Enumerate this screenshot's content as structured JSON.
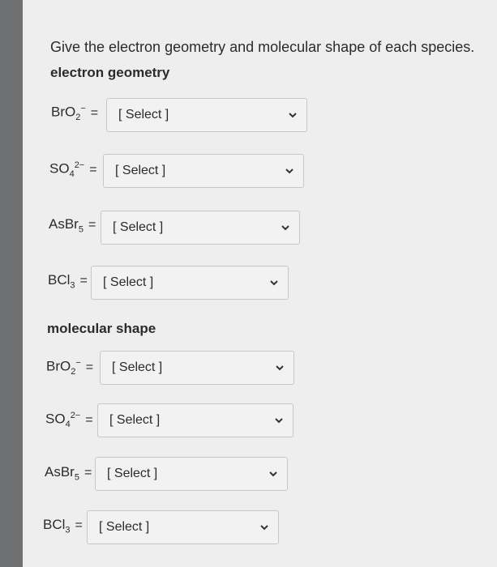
{
  "heading": "Give the electron geometry and molecular shape of each species.",
  "sections": {
    "electron_geometry": "electron geometry",
    "molecular_shape": "molecular shape"
  },
  "species": {
    "bro2": {
      "main": "BrO",
      "sub": "2",
      "sup": "−"
    },
    "so4": {
      "main": "SO",
      "sub": "4",
      "sup": "2−"
    },
    "asbr5": {
      "main": "AsBr",
      "sub": "5",
      "sup": ""
    },
    "bcl3": {
      "main": "BCl",
      "sub": "3",
      "sup": ""
    }
  },
  "equals": "=",
  "select_placeholder": "[ Select ]",
  "icons": {
    "dropdown": "chevron-down-icon"
  }
}
